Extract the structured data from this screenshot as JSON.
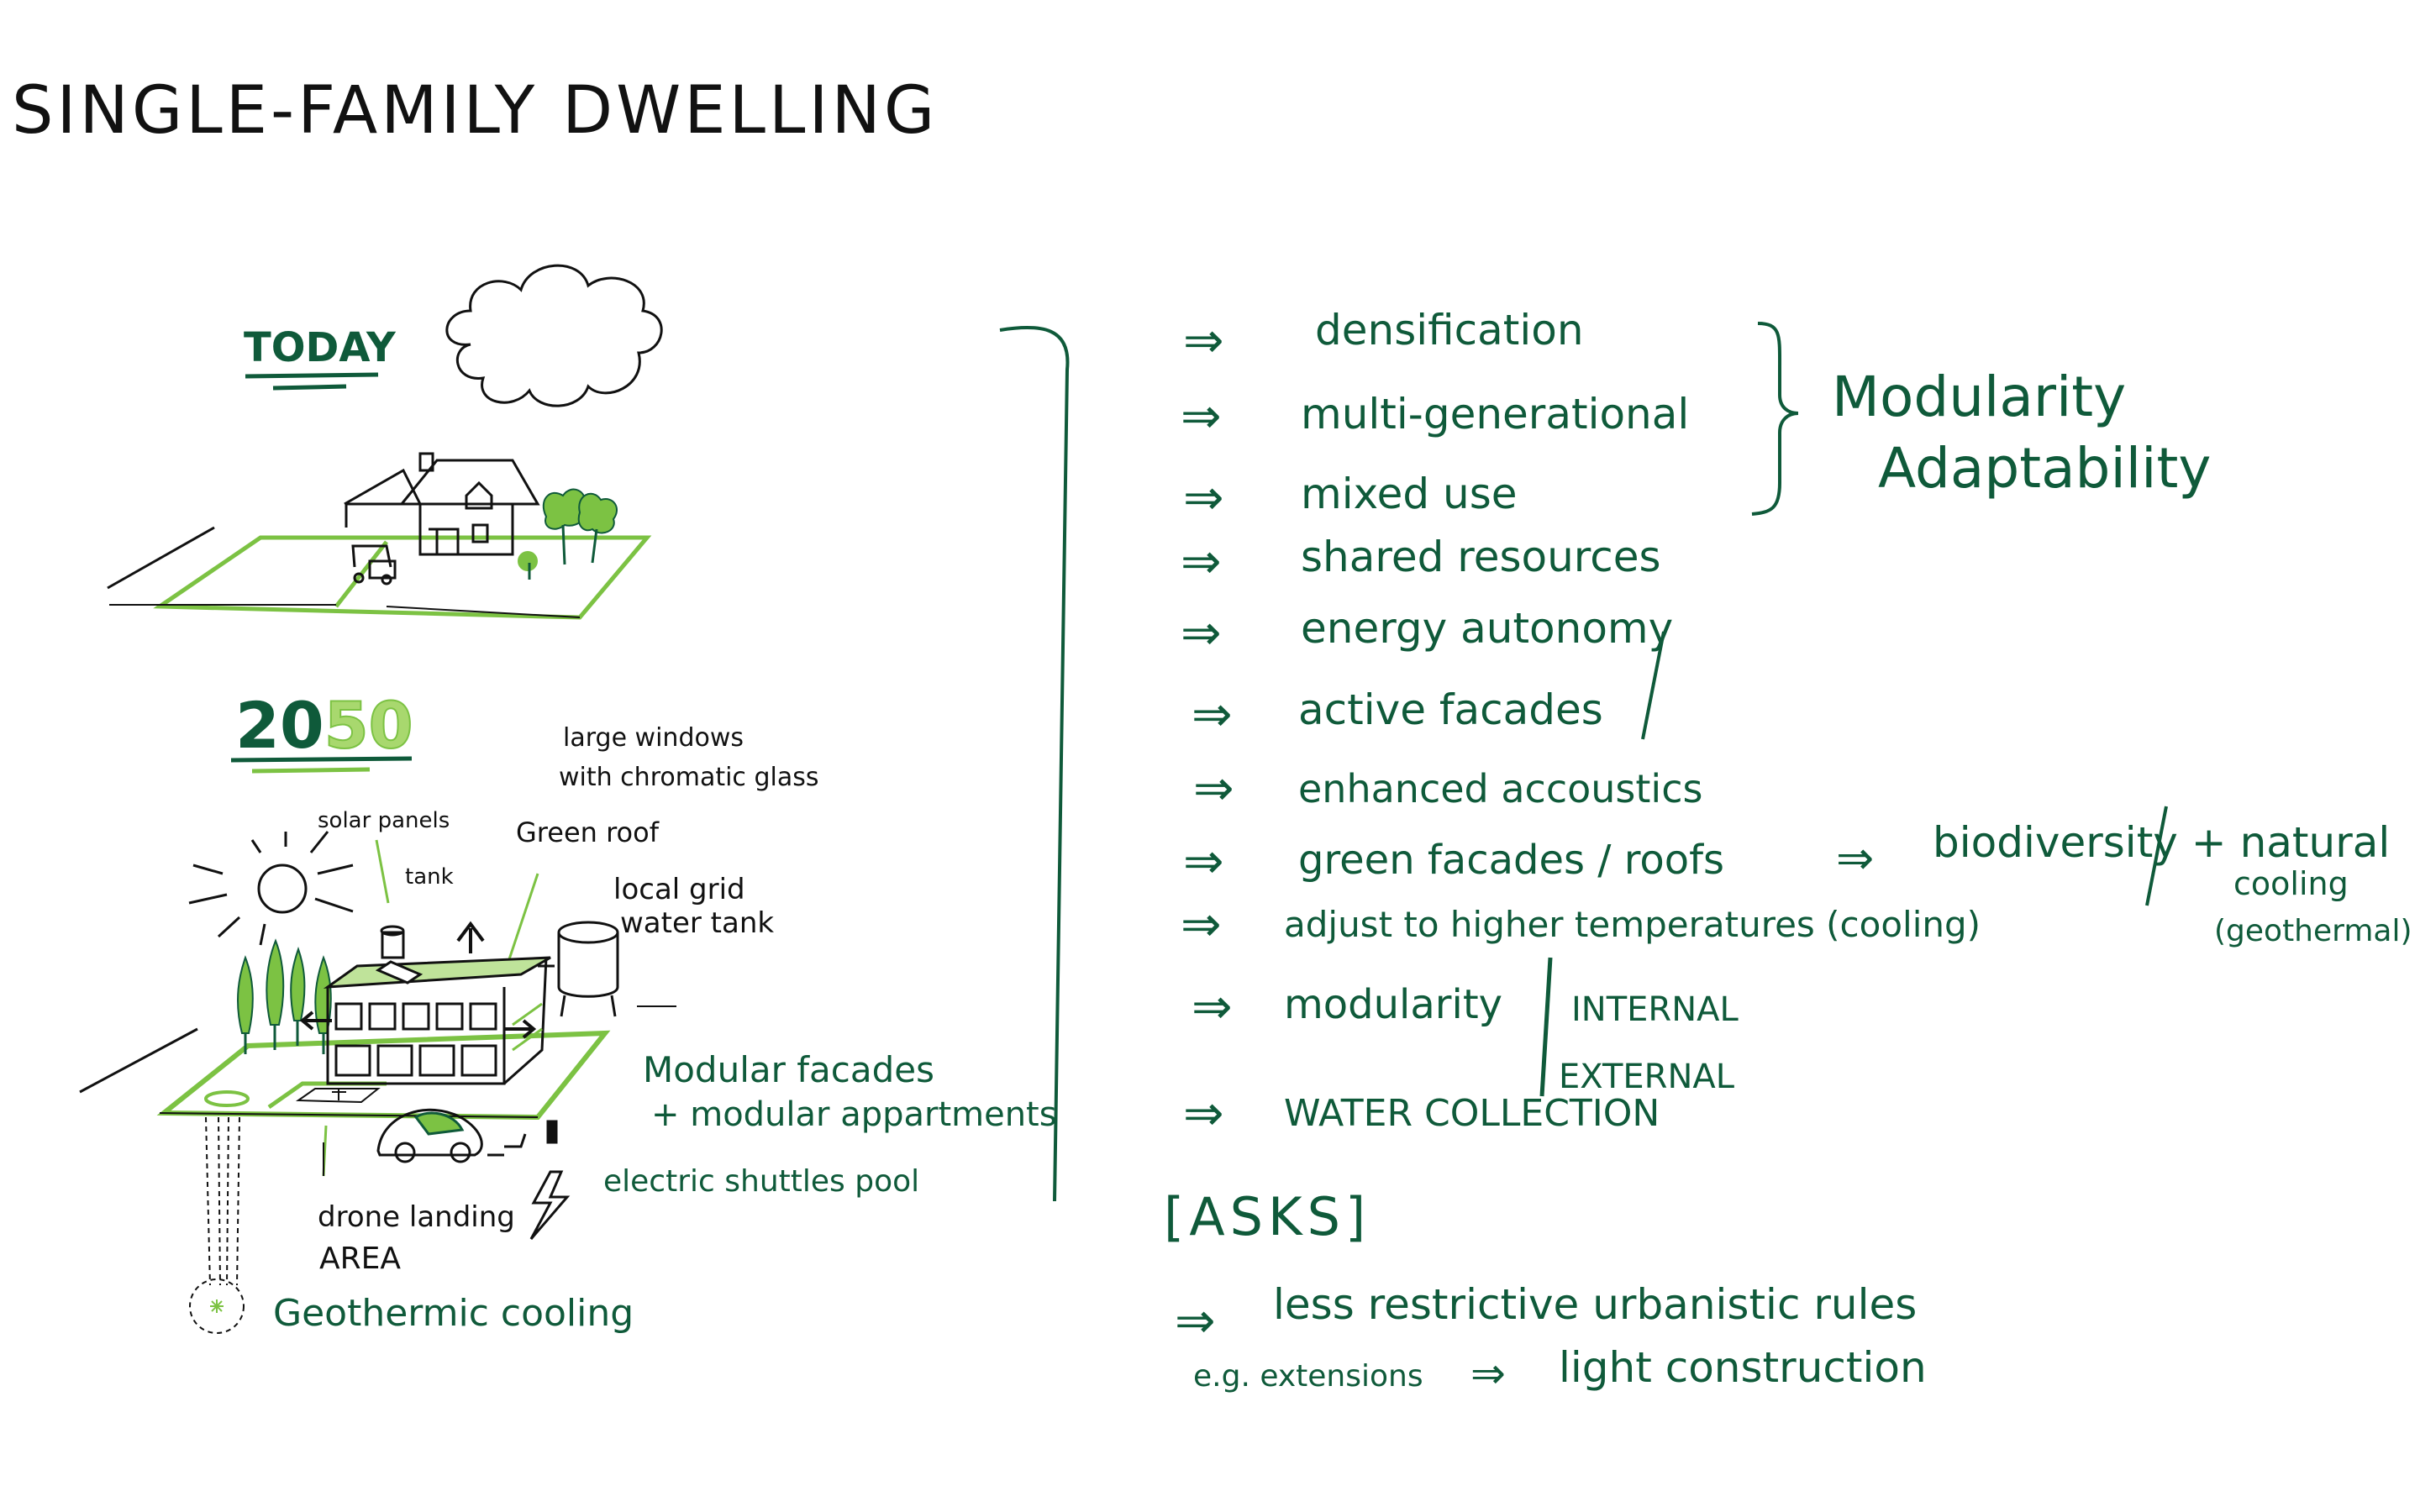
{
  "title": "SINGLE-FAMILY DWELLING",
  "today": {
    "label": "TODAY"
  },
  "future": {
    "year_part1": "20",
    "year_part2": "50",
    "labels": {
      "large_windows_line1": "large windows",
      "large_windows_line2": "with chromatic glass",
      "solar_panels": "solar panels",
      "tank": "tank",
      "green_roof": "Green roof",
      "local_grid_line1": "local grid",
      "local_grid_line2": "water tank",
      "modular_line1": "Modular facades",
      "modular_line2": "+ modular appartments",
      "shuttles": "electric shuttles pool",
      "drone_line1": "drone landing",
      "drone_line2": "AREA",
      "geothermic": "Geothermic cooling"
    }
  },
  "trends": [
    "densification",
    "multi-generational",
    "mixed use",
    "shared resources",
    "energy autonomy",
    "active facades",
    "enhanced accoustics",
    "green facades / roofs",
    "adjust to higher temperatures (cooling)",
    "modularity",
    "WATER COLLECTION"
  ],
  "arrow_symbol": "⇒",
  "modularity_group": {
    "line1": "Modularity",
    "line2": "Adaptability"
  },
  "biodiversity": {
    "text": "biodiversity + natural",
    "cooling": "cooling",
    "geothermal": "(geothermal)"
  },
  "modularity_sub": {
    "internal": "INTERNAL",
    "external": "EXTERNAL"
  },
  "asks": {
    "label": "[ASKS]",
    "item1": "less restrictive urbanistic rules",
    "item2_prefix": "e.g. extensions",
    "item2_suffix": "light construction"
  },
  "colors": {
    "black": "#111111",
    "dark_green": "#0f5a3a",
    "light_green": "#7cc243"
  }
}
